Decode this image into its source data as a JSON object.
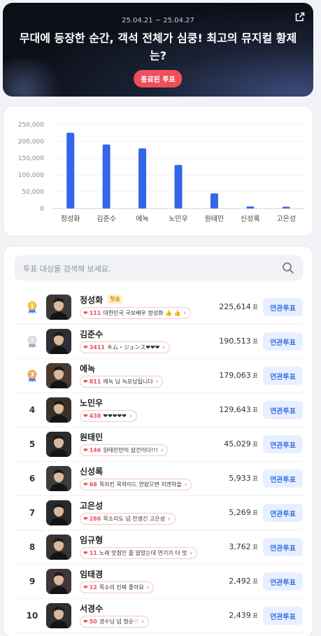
{
  "banner": {
    "date_range": "25.04.21 ~ 25.04.27",
    "title": "무대에 등장한 순간, 객석 전체가 심쿵! 최고의 뮤지컬 황제는?",
    "status": "종료된 투표"
  },
  "chart_data": {
    "type": "bar",
    "categories": [
      "정성화",
      "김준수",
      "에녹",
      "노민우",
      "원태민",
      "신성록",
      "고은성"
    ],
    "values": [
      225614,
      190513,
      179063,
      129643,
      45029,
      5933,
      5269
    ],
    "yticks": [
      "0",
      "50,000",
      "100,000",
      "150,000",
      "200,000",
      "250,000"
    ],
    "ylim": [
      0,
      250000
    ],
    "color": "#3366e8"
  },
  "search": {
    "placeholder": "투표 대상을 검색해 보세요."
  },
  "vote_unit": "표",
  "related_label": "연관투표",
  "ranking": [
    {
      "rank": "1",
      "medal": "gold",
      "name": "정성화",
      "badge": "첫승",
      "count": "111",
      "comment": "대한민국 국보배우 정성화 👍 👍",
      "votes": "225,614"
    },
    {
      "rank": "2",
      "medal": "silver",
      "name": "김준수",
      "count": "3411",
      "comment": "キム・ジュンス❤❤❤",
      "votes": "190,513"
    },
    {
      "rank": "3",
      "medal": "bronze",
      "name": "에녹",
      "count": "811",
      "comment": "에녹 님 녹모낭됩니다",
      "votes": "179,063"
    },
    {
      "rank": "4",
      "name": "노민우",
      "count": "438",
      "comment": "❤❤❤❤❤",
      "votes": "129,643"
    },
    {
      "rank": "5",
      "name": "원태민",
      "count": "146",
      "comment": "원태민만이 살건이다!!!",
      "votes": "45,029"
    },
    {
      "rank": "6",
      "name": "신성록",
      "count": "68",
      "comment": "목자킨 목하이드 연왔으면 지엔하을",
      "votes": "5,933"
    },
    {
      "rank": "7",
      "name": "고은성",
      "count": "286",
      "comment": "목소리도 넘 잔생긴 고은성",
      "votes": "5,269"
    },
    {
      "rank": "8",
      "name": "임규형",
      "count": "11",
      "comment": "노래 맛침인 줄 알았는데 연기가 더 맛",
      "votes": "3,762"
    },
    {
      "rank": "9",
      "name": "임태경",
      "count": "12",
      "comment": "목소리 진짜 좋아요",
      "votes": "2,492"
    },
    {
      "rank": "10",
      "name": "서경수",
      "count": "50",
      "comment": "경수님 넘 청순♡",
      "votes": "2,439"
    }
  ]
}
